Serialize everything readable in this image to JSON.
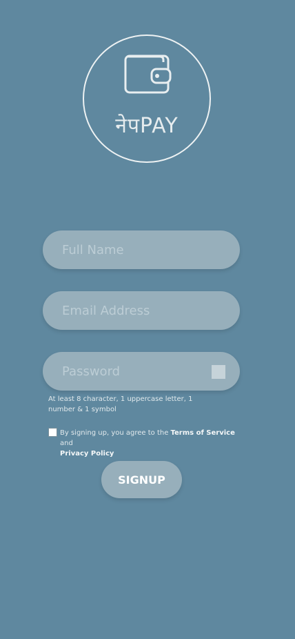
{
  "logo": {
    "icon": "wallet-icon",
    "text": "नेपPAY"
  },
  "form": {
    "full_name_placeholder": "Full Name",
    "email_placeholder": "Email Address",
    "password_placeholder": "Password",
    "password_hint": "At least 8 character, 1 uppercase letter, 1 number & 1 symbol",
    "agree_prefix": "By signing up, you agree to the ",
    "terms_label": "Terms of Service",
    "agree_and": " and ",
    "privacy_label": "Privacy Policy",
    "signup_label": "SIGNUP"
  },
  "colors": {
    "background": "#5f889f",
    "field_bg": "#97afbb",
    "text_light": "#e1e9ec"
  }
}
